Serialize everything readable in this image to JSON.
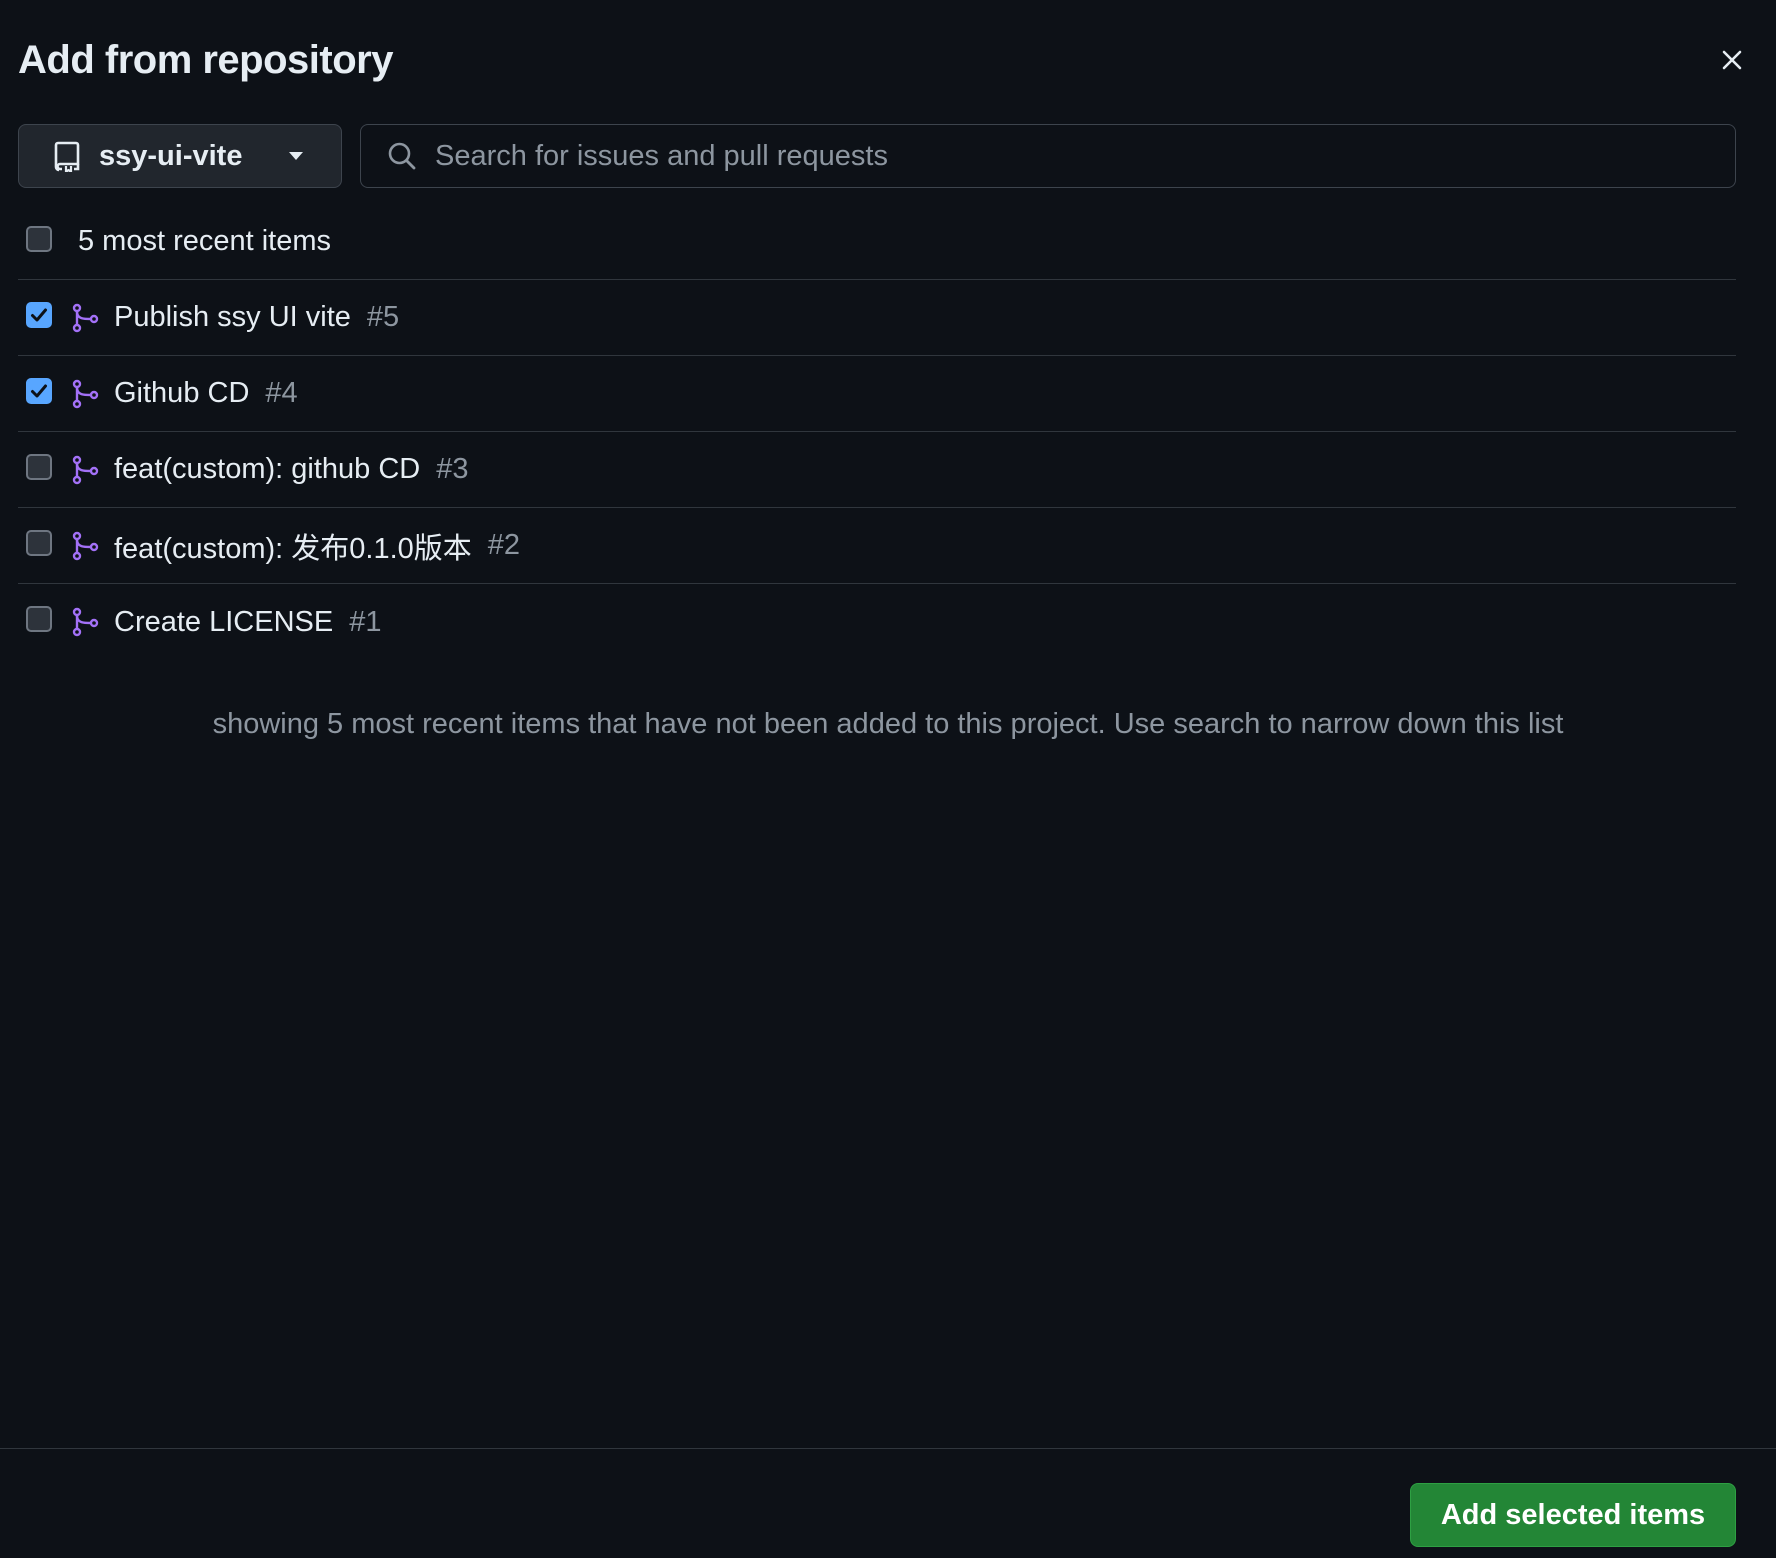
{
  "dialog": {
    "title": "Add from repository",
    "close_label": "Close"
  },
  "repo_selector": {
    "icon": "repo-icon",
    "name": "ssy-ui-vite",
    "caret_icon": "triangle-down-icon"
  },
  "search": {
    "icon": "search-icon",
    "placeholder": "Search for issues and pull requests",
    "value": ""
  },
  "select_all": {
    "label": "5 most recent items",
    "checked": false
  },
  "items": [
    {
      "title": "Publish ssy UI vite",
      "number": "#5",
      "checked": true,
      "icon": "git-pull-request-icon"
    },
    {
      "title": "Github CD",
      "number": "#4",
      "checked": true,
      "icon": "git-pull-request-icon"
    },
    {
      "title": "feat(custom): github CD",
      "number": "#3",
      "checked": false,
      "icon": "git-pull-request-icon"
    },
    {
      "title": "feat(custom): 发布0.1.0版本",
      "number": "#2",
      "checked": false,
      "icon": "git-pull-request-icon"
    },
    {
      "title": "Create LICENSE",
      "number": "#1",
      "checked": false,
      "icon": "git-pull-request-icon"
    }
  ],
  "hint": "showing 5 most recent items that have not been added to this project. Use search to narrow down this list",
  "footer": {
    "add_button_label": "Add selected items"
  },
  "colors": {
    "background": "#0d1117",
    "checkbox_checked": "#58a6ff",
    "pr_icon": "#a371f7",
    "primary_button": "#238636"
  }
}
